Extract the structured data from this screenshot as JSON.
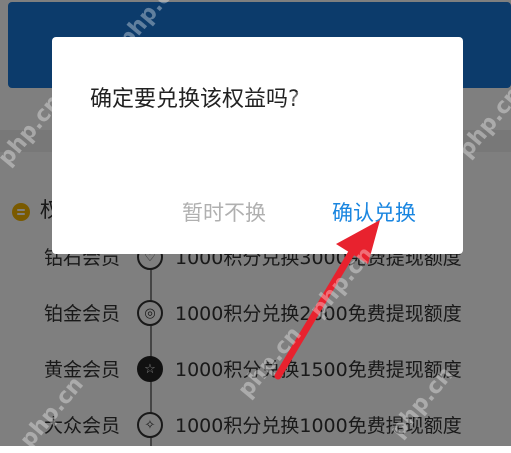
{
  "background": {
    "section_title": "权",
    "levels": [
      {
        "name": "钻石会员",
        "badge": "♡",
        "badge_style": "outline",
        "desc": "1000积分兑换3000免费提现额度"
      },
      {
        "name": "铂金会员",
        "badge": "◎",
        "badge_style": "outline",
        "desc": "1000积分兑换2000免费提现额度"
      },
      {
        "name": "黄金会员",
        "badge": "☆",
        "badge_style": "filled",
        "desc": "1000积分兑换1500免费提现额度"
      },
      {
        "name": "大众会员",
        "badge": "✧",
        "badge_style": "outline",
        "desc": "1000积分兑换1000免费提现额度"
      }
    ]
  },
  "dialog": {
    "message": "确定要兑换该权益吗?",
    "cancel_label": "暂时不换",
    "confirm_label": "确认兑换"
  },
  "watermark": {
    "text": "php.cn"
  },
  "colors": {
    "banner": "#1876d6",
    "confirm": "#1a86e0",
    "cancel": "#b0b0b0",
    "arrow": "#e8222e",
    "section_icon": "#f5b400"
  }
}
